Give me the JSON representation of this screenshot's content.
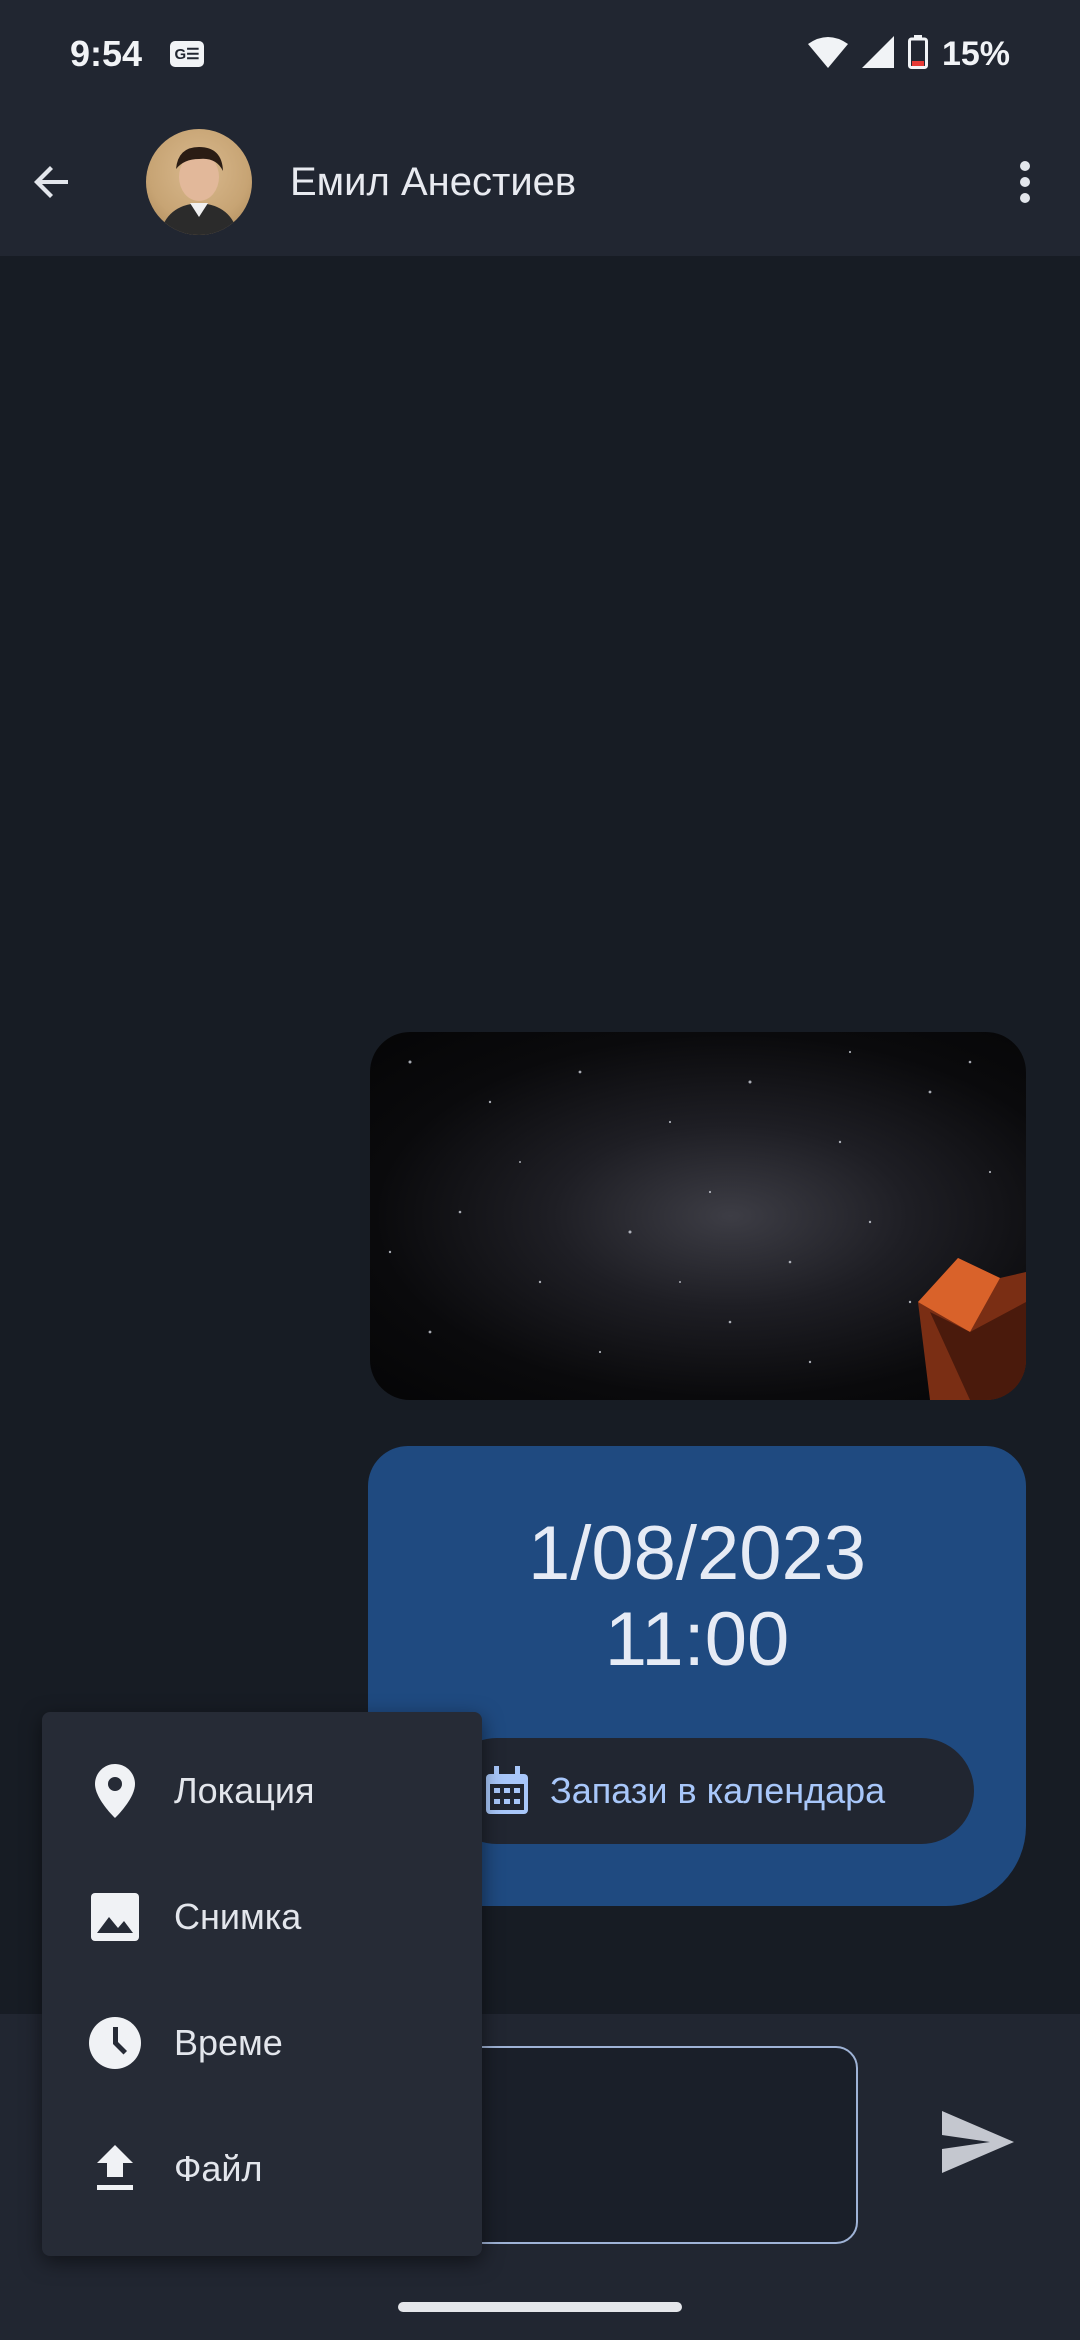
{
  "status_bar": {
    "time": "9:54",
    "badge": "G☰",
    "battery_text": "15%",
    "icons": [
      "wifi-icon",
      "signal-icon",
      "battery-icon"
    ]
  },
  "header": {
    "back_icon": "arrow-back-icon",
    "contact_name": "Емил Анестиев",
    "more_icon": "more-vert-icon"
  },
  "messages": [
    {
      "type": "image",
      "description_icon": "photo-icon"
    },
    {
      "type": "event",
      "date": "1/08/2023",
      "time": "11:00",
      "action_label": "Запази в календара",
      "action_icon": "calendar-icon"
    }
  ],
  "attach_menu": {
    "items": [
      {
        "label": "Локация",
        "icon": "location-pin-icon"
      },
      {
        "label": "Снимка",
        "icon": "image-icon"
      },
      {
        "label": "Време",
        "icon": "clock-icon"
      },
      {
        "label": "Файл",
        "icon": "upload-icon"
      }
    ]
  },
  "composer": {
    "placeholder": "",
    "send_icon": "send-icon"
  },
  "colors": {
    "background": "#171c24",
    "bar": "#212631",
    "bubble": "#1f4a80",
    "accent": "#a8c7fa"
  }
}
